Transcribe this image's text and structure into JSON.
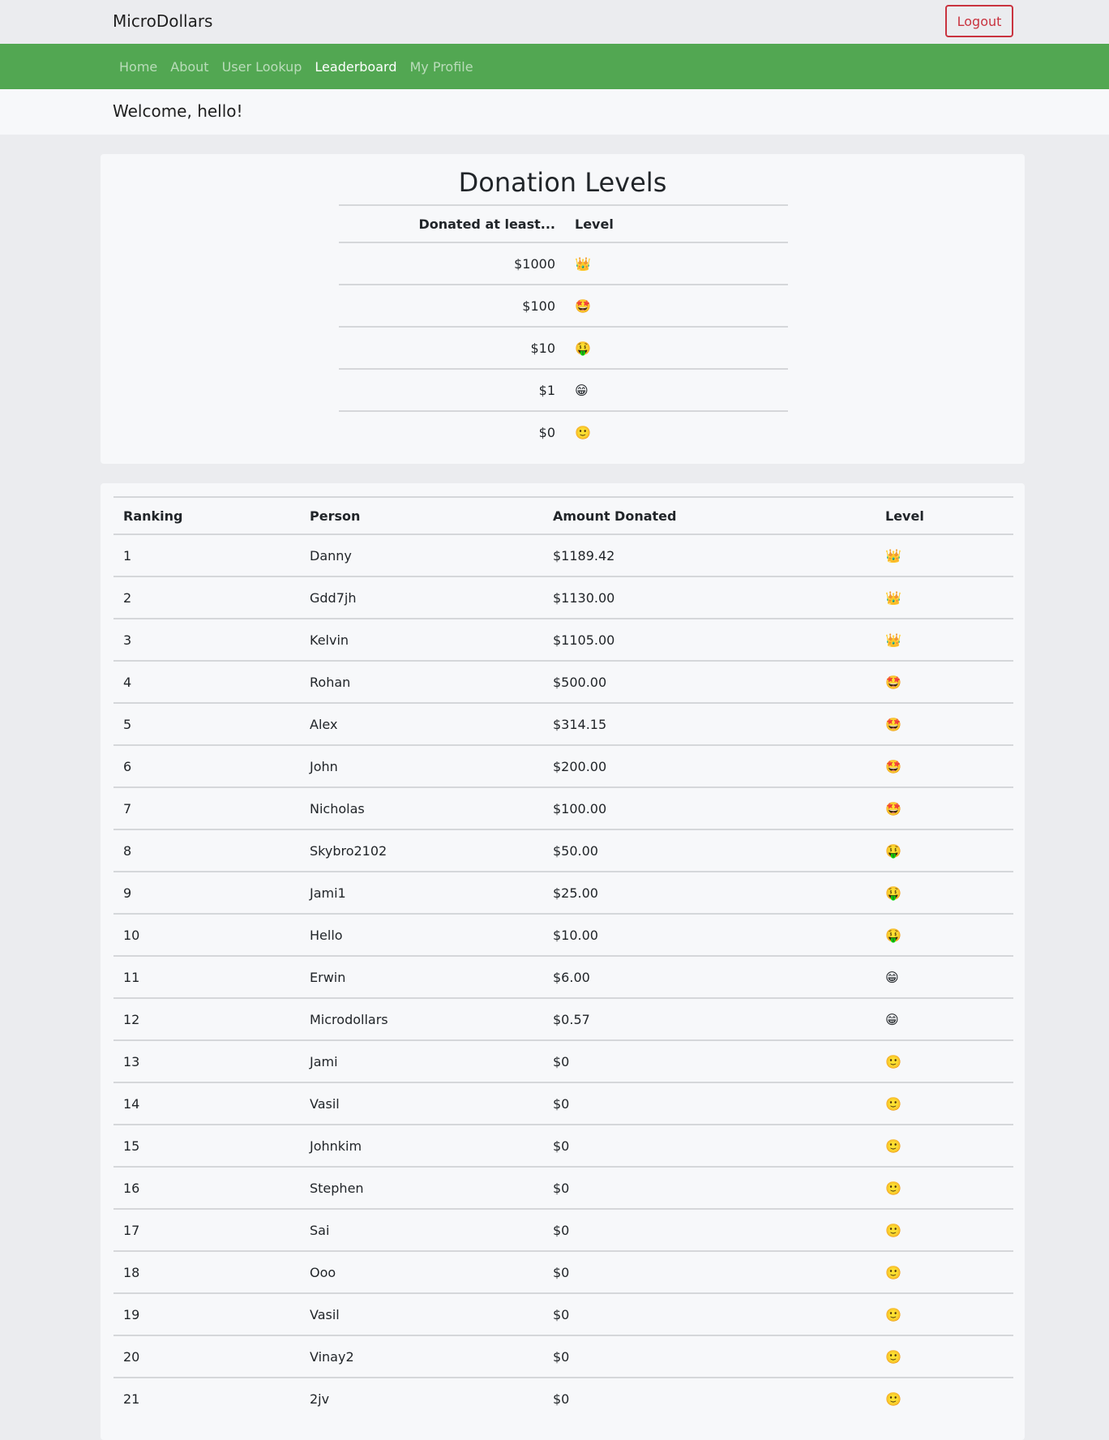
{
  "header": {
    "brand": "MicroDollars",
    "logout_label": "Logout"
  },
  "nav": {
    "items": [
      {
        "label": "Home",
        "active": false
      },
      {
        "label": "About",
        "active": false
      },
      {
        "label": "User Lookup",
        "active": false
      },
      {
        "label": "Leaderboard",
        "active": true
      },
      {
        "label": "My Profile",
        "active": false
      }
    ]
  },
  "welcome": "Welcome, hello!",
  "donation_levels": {
    "title": "Donation Levels",
    "headers": {
      "amount": "Donated at least...",
      "level": "Level"
    },
    "rows": [
      {
        "amount": "$1000",
        "level": "👑"
      },
      {
        "amount": "$100",
        "level": "🤩"
      },
      {
        "amount": "$10",
        "level": "🤑"
      },
      {
        "amount": "$1",
        "level": "😁"
      },
      {
        "amount": "$0",
        "level": "🙂"
      }
    ]
  },
  "leaderboard": {
    "headers": {
      "ranking": "Ranking",
      "person": "Person",
      "amount": "Amount Donated",
      "level": "Level"
    },
    "rows": [
      {
        "rank": "1",
        "person": "Danny",
        "amount": "$1189.42",
        "level": "👑"
      },
      {
        "rank": "2",
        "person": "Gdd7jh",
        "amount": "$1130.00",
        "level": "👑"
      },
      {
        "rank": "3",
        "person": "Kelvin",
        "amount": "$1105.00",
        "level": "👑"
      },
      {
        "rank": "4",
        "person": "Rohan",
        "amount": "$500.00",
        "level": "🤩"
      },
      {
        "rank": "5",
        "person": "Alex",
        "amount": "$314.15",
        "level": "🤩"
      },
      {
        "rank": "6",
        "person": "John",
        "amount": "$200.00",
        "level": "🤩"
      },
      {
        "rank": "7",
        "person": "Nicholas",
        "amount": "$100.00",
        "level": "🤩"
      },
      {
        "rank": "8",
        "person": "Skybro2102",
        "amount": "$50.00",
        "level": "🤑"
      },
      {
        "rank": "9",
        "person": "Jami1",
        "amount": "$25.00",
        "level": "🤑"
      },
      {
        "rank": "10",
        "person": "Hello",
        "amount": "$10.00",
        "level": "🤑"
      },
      {
        "rank": "11",
        "person": "Erwin",
        "amount": "$6.00",
        "level": "😁"
      },
      {
        "rank": "12",
        "person": "Microdollars",
        "amount": "$0.57",
        "level": "😁"
      },
      {
        "rank": "13",
        "person": "Jami",
        "amount": "$0",
        "level": "🙂"
      },
      {
        "rank": "14",
        "person": "Vasil",
        "amount": "$0",
        "level": "🙂"
      },
      {
        "rank": "15",
        "person": "Johnkim",
        "amount": "$0",
        "level": "🙂"
      },
      {
        "rank": "16",
        "person": "Stephen",
        "amount": "$0",
        "level": "🙂"
      },
      {
        "rank": "17",
        "person": "Sai",
        "amount": "$0",
        "level": "🙂"
      },
      {
        "rank": "18",
        "person": "Ooo",
        "amount": "$0",
        "level": "🙂"
      },
      {
        "rank": "19",
        "person": "Vasil",
        "amount": "$0",
        "level": "🙂"
      },
      {
        "rank": "20",
        "person": "Vinay2",
        "amount": "$0",
        "level": "🙂"
      },
      {
        "rank": "21",
        "person": "2jv",
        "amount": "$0",
        "level": "🙂"
      }
    ]
  }
}
